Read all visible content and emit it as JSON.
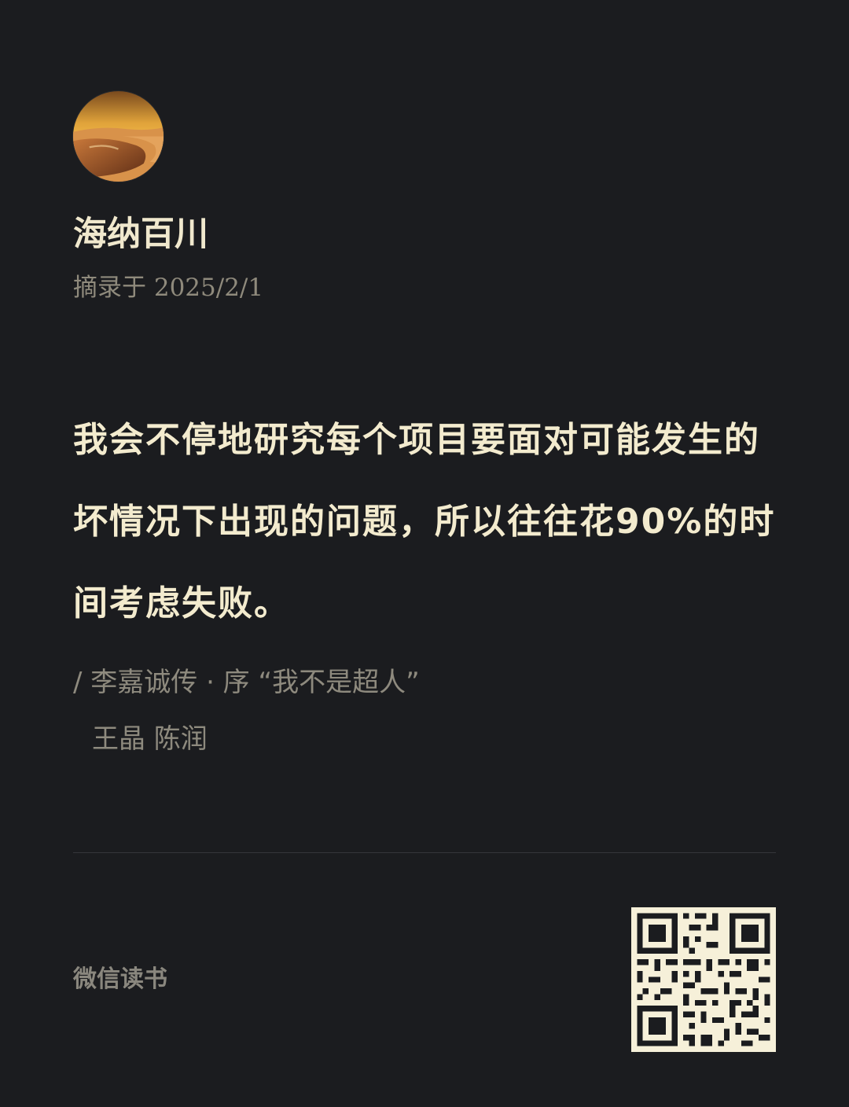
{
  "profile": {
    "avatar_icon": "sunset-landscape-avatar",
    "username": "海纳百川",
    "excerpt_date": "摘录于 2025/2/1"
  },
  "quote": {
    "text": "我会不停地研究每个项目要面对可能发生的坏情况下出现的问题，所以往往花90%的时间考虑失败。"
  },
  "source": {
    "line": "/ 李嘉诚传 · 序 “我不是超人”",
    "authors": "王晶 陈润"
  },
  "footer": {
    "brand": "微信读书",
    "qr_icon": "qr-code-icon"
  },
  "colors": {
    "background": "#1b1c1f",
    "primary_text": "#f1e9cf",
    "secondary_text": "#8e8a7e",
    "divider": "#35363a",
    "qr_background": "#f6f0d9"
  }
}
